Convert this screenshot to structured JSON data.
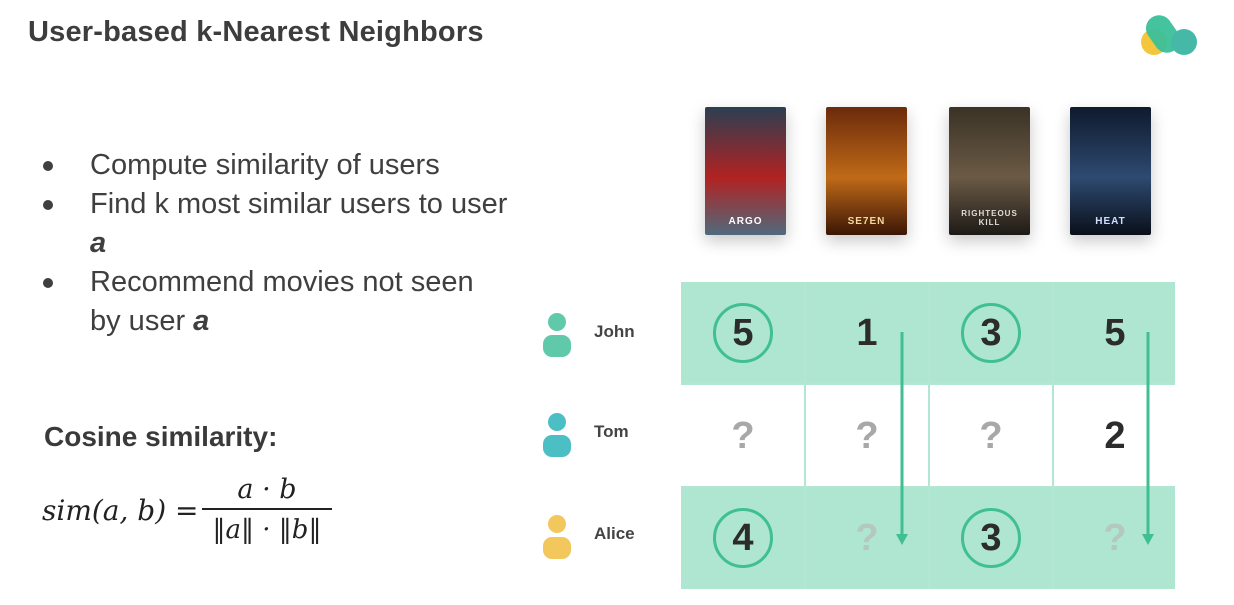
{
  "title": "User-based k-Nearest Neighbors",
  "bullets": [
    {
      "text": "Compute similarity of users",
      "emphasis": ""
    },
    {
      "text": "Find k most similar users to user ",
      "emphasis": "a"
    },
    {
      "text": "Recommend movies not seen by user ",
      "emphasis": "a"
    }
  ],
  "cosine": {
    "title": "Cosine similarity:",
    "lhs": "sim(a, b) =",
    "numerator": "a · b",
    "denominator": "‖a‖ · ‖b‖"
  },
  "movies": [
    {
      "caption": "ARGO",
      "colors": [
        "#2b3f52",
        "#b22222",
        "#506a7c"
      ]
    },
    {
      "caption": "SE7EN",
      "colors": [
        "#6b2a0b",
        "#c06a18",
        "#3b1606"
      ]
    },
    {
      "caption": "RIGHTEOUS KILL",
      "colors": [
        "#3a3226",
        "#6b5a45",
        "#1d1a16"
      ]
    },
    {
      "caption": "HEAT",
      "colors": [
        "#0e1a2e",
        "#2e4a70",
        "#0a0f1a"
      ]
    }
  ],
  "users": [
    {
      "name": "John",
      "color": "#5fc9a9"
    },
    {
      "name": "Tom",
      "color": "#4bbfc4"
    },
    {
      "name": "Alice",
      "color": "#f2c75c"
    }
  ],
  "ratings": [
    [
      {
        "v": "5",
        "circled": true
      },
      {
        "v": "1",
        "circled": false
      },
      {
        "v": "3",
        "circled": true
      },
      {
        "v": "5",
        "circled": false
      }
    ],
    [
      {
        "v": "?",
        "circled": false
      },
      {
        "v": "?",
        "circled": false
      },
      {
        "v": "?",
        "circled": false
      },
      {
        "v": "2",
        "circled": false
      }
    ],
    [
      {
        "v": "4",
        "circled": true
      },
      {
        "v": "?",
        "circled": false
      },
      {
        "v": "3",
        "circled": true
      },
      {
        "v": "?",
        "circled": false
      }
    ]
  ],
  "colors": {
    "highlight_row": "#aee6d1",
    "plain_row": "#ffffff",
    "accent": "#3fbf92",
    "logo_yellow": "#f4c63d",
    "logo_green": "#3bbf99"
  },
  "highlighted_rows": [
    0,
    2
  ],
  "arrows": [
    {
      "column": 1,
      "from_row": 0,
      "to_row": 2
    },
    {
      "column": 3,
      "from_row": 0,
      "to_row": 2
    }
  ]
}
